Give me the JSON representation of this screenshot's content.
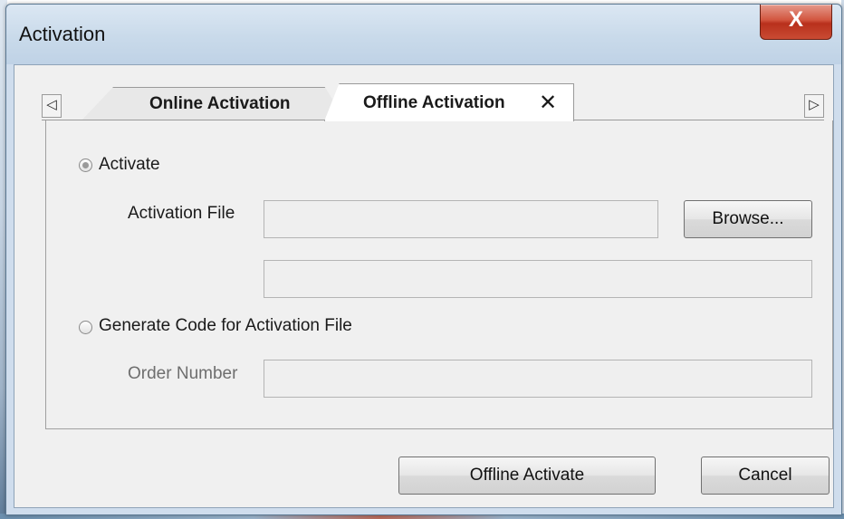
{
  "window": {
    "title": "Activation",
    "close_glyph": "X"
  },
  "tabs": {
    "scroll_left_glyph": "◁",
    "scroll_right_glyph": "▷",
    "items": [
      {
        "label": "Online Activation",
        "active": false
      },
      {
        "label": "Offline Activation",
        "active": true,
        "close_glyph": "✕"
      }
    ]
  },
  "activate_option": {
    "label": "Activate",
    "checked": true,
    "file_label": "Activation File",
    "file_value": "",
    "second_value": "",
    "browse_label": "Browse..."
  },
  "generate_option": {
    "label": "Generate Code for Activation File",
    "checked": false,
    "order_label": "Order Number",
    "order_value": ""
  },
  "footer": {
    "primary_label": "Offline Activate",
    "cancel_label": "Cancel"
  },
  "icons": {
    "close": "close-icon",
    "tab_close": "tab-close-icon",
    "scroll_left": "chevron-left-icon",
    "scroll_right": "chevron-right-icon"
  },
  "colors": {
    "close_button": "#c94b33",
    "titlebar": "#c9daea",
    "client_bg": "#f0f0f0"
  }
}
